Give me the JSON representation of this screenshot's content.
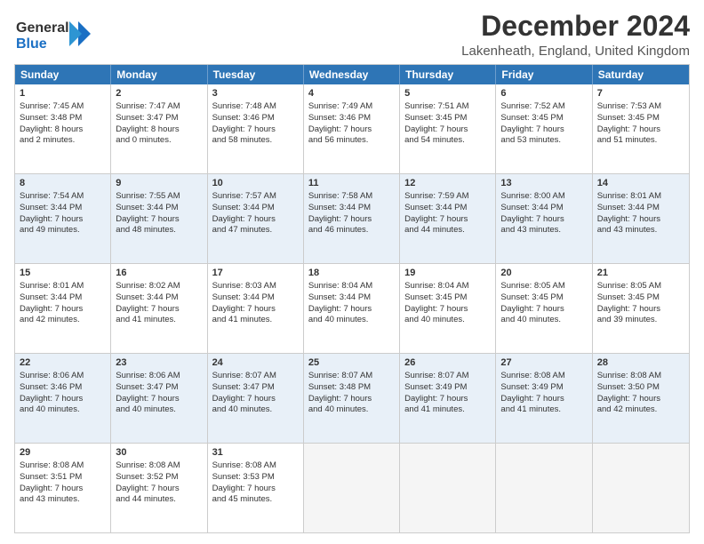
{
  "logo": {
    "line1": "General",
    "line2": "Blue",
    "icon": "▶"
  },
  "title": "December 2024",
  "subtitle": "Lakenheath, England, United Kingdom",
  "weekdays": [
    "Sunday",
    "Monday",
    "Tuesday",
    "Wednesday",
    "Thursday",
    "Friday",
    "Saturday"
  ],
  "rows": [
    {
      "alt": false,
      "cells": [
        {
          "day": "1",
          "info": "Sunrise: 7:45 AM\nSunset: 3:48 PM\nDaylight: 8 hours\nand 2 minutes."
        },
        {
          "day": "2",
          "info": "Sunrise: 7:47 AM\nSunset: 3:47 PM\nDaylight: 8 hours\nand 0 minutes."
        },
        {
          "day": "3",
          "info": "Sunrise: 7:48 AM\nSunset: 3:46 PM\nDaylight: 7 hours\nand 58 minutes."
        },
        {
          "day": "4",
          "info": "Sunrise: 7:49 AM\nSunset: 3:46 PM\nDaylight: 7 hours\nand 56 minutes."
        },
        {
          "day": "5",
          "info": "Sunrise: 7:51 AM\nSunset: 3:45 PM\nDaylight: 7 hours\nand 54 minutes."
        },
        {
          "day": "6",
          "info": "Sunrise: 7:52 AM\nSunset: 3:45 PM\nDaylight: 7 hours\nand 53 minutes."
        },
        {
          "day": "7",
          "info": "Sunrise: 7:53 AM\nSunset: 3:45 PM\nDaylight: 7 hours\nand 51 minutes."
        }
      ]
    },
    {
      "alt": true,
      "cells": [
        {
          "day": "8",
          "info": "Sunrise: 7:54 AM\nSunset: 3:44 PM\nDaylight: 7 hours\nand 49 minutes."
        },
        {
          "day": "9",
          "info": "Sunrise: 7:55 AM\nSunset: 3:44 PM\nDaylight: 7 hours\nand 48 minutes."
        },
        {
          "day": "10",
          "info": "Sunrise: 7:57 AM\nSunset: 3:44 PM\nDaylight: 7 hours\nand 47 minutes."
        },
        {
          "day": "11",
          "info": "Sunrise: 7:58 AM\nSunset: 3:44 PM\nDaylight: 7 hours\nand 46 minutes."
        },
        {
          "day": "12",
          "info": "Sunrise: 7:59 AM\nSunset: 3:44 PM\nDaylight: 7 hours\nand 44 minutes."
        },
        {
          "day": "13",
          "info": "Sunrise: 8:00 AM\nSunset: 3:44 PM\nDaylight: 7 hours\nand 43 minutes."
        },
        {
          "day": "14",
          "info": "Sunrise: 8:01 AM\nSunset: 3:44 PM\nDaylight: 7 hours\nand 43 minutes."
        }
      ]
    },
    {
      "alt": false,
      "cells": [
        {
          "day": "15",
          "info": "Sunrise: 8:01 AM\nSunset: 3:44 PM\nDaylight: 7 hours\nand 42 minutes."
        },
        {
          "day": "16",
          "info": "Sunrise: 8:02 AM\nSunset: 3:44 PM\nDaylight: 7 hours\nand 41 minutes."
        },
        {
          "day": "17",
          "info": "Sunrise: 8:03 AM\nSunset: 3:44 PM\nDaylight: 7 hours\nand 41 minutes."
        },
        {
          "day": "18",
          "info": "Sunrise: 8:04 AM\nSunset: 3:44 PM\nDaylight: 7 hours\nand 40 minutes."
        },
        {
          "day": "19",
          "info": "Sunrise: 8:04 AM\nSunset: 3:45 PM\nDaylight: 7 hours\nand 40 minutes."
        },
        {
          "day": "20",
          "info": "Sunrise: 8:05 AM\nSunset: 3:45 PM\nDaylight: 7 hours\nand 40 minutes."
        },
        {
          "day": "21",
          "info": "Sunrise: 8:05 AM\nSunset: 3:45 PM\nDaylight: 7 hours\nand 39 minutes."
        }
      ]
    },
    {
      "alt": true,
      "cells": [
        {
          "day": "22",
          "info": "Sunrise: 8:06 AM\nSunset: 3:46 PM\nDaylight: 7 hours\nand 40 minutes."
        },
        {
          "day": "23",
          "info": "Sunrise: 8:06 AM\nSunset: 3:47 PM\nDaylight: 7 hours\nand 40 minutes."
        },
        {
          "day": "24",
          "info": "Sunrise: 8:07 AM\nSunset: 3:47 PM\nDaylight: 7 hours\nand 40 minutes."
        },
        {
          "day": "25",
          "info": "Sunrise: 8:07 AM\nSunset: 3:48 PM\nDaylight: 7 hours\nand 40 minutes."
        },
        {
          "day": "26",
          "info": "Sunrise: 8:07 AM\nSunset: 3:49 PM\nDaylight: 7 hours\nand 41 minutes."
        },
        {
          "day": "27",
          "info": "Sunrise: 8:08 AM\nSunset: 3:49 PM\nDaylight: 7 hours\nand 41 minutes."
        },
        {
          "day": "28",
          "info": "Sunrise: 8:08 AM\nSunset: 3:50 PM\nDaylight: 7 hours\nand 42 minutes."
        }
      ]
    },
    {
      "alt": false,
      "cells": [
        {
          "day": "29",
          "info": "Sunrise: 8:08 AM\nSunset: 3:51 PM\nDaylight: 7 hours\nand 43 minutes."
        },
        {
          "day": "30",
          "info": "Sunrise: 8:08 AM\nSunset: 3:52 PM\nDaylight: 7 hours\nand 44 minutes."
        },
        {
          "day": "31",
          "info": "Sunrise: 8:08 AM\nSunset: 3:53 PM\nDaylight: 7 hours\nand 45 minutes."
        },
        {
          "day": "",
          "info": ""
        },
        {
          "day": "",
          "info": ""
        },
        {
          "day": "",
          "info": ""
        },
        {
          "day": "",
          "info": ""
        }
      ]
    }
  ]
}
